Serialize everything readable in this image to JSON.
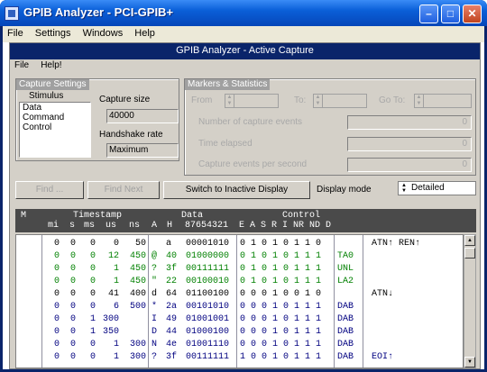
{
  "window": {
    "title": "GPIB Analyzer - PCI-GPIB+",
    "minimize": "–",
    "maximize": "□",
    "close": "✕"
  },
  "menubar": [
    {
      "label": "File"
    },
    {
      "label": "Settings"
    },
    {
      "label": "Windows"
    },
    {
      "label": "Help"
    }
  ],
  "child": {
    "title": "GPIB Analyzer - Active Capture",
    "menu": [
      {
        "label": "File"
      },
      {
        "label": "Help!"
      }
    ]
  },
  "capture_settings": {
    "caption": "Capture Settings",
    "stimulus_label": "Stimulus",
    "stimulus_items": [
      "Data",
      "Command",
      "Control"
    ],
    "capture_size_label": "Capture size",
    "capture_size_value": "40000",
    "handshake_label": "Handshake rate",
    "handshake_value": "Maximum"
  },
  "markers": {
    "caption": "Markers & Statistics",
    "from_label": "From",
    "to_label": "To:",
    "goto_label": "Go To:",
    "num_events_label": "Number of capture events",
    "num_events_value": "0",
    "time_elapsed_label": "Time elapsed",
    "time_elapsed_value": "0",
    "events_per_sec_label": "Capture events per second",
    "events_per_sec_value": "0"
  },
  "toolbar": {
    "find_label": "Find ...",
    "find_next_label": "Find Next",
    "switch_label": "Switch to Inactive Display",
    "display_mode_label": "Display mode",
    "display_mode_value": "Detailed"
  },
  "table": {
    "header_top": {
      "m": "M",
      "timestamp": "Timestamp",
      "data": "Data",
      "control": "Control"
    },
    "header_sub": {
      "mi": "mi",
      "s": "s",
      "ms": "ms",
      "us": "us",
      "ns": "ns",
      "a": "A",
      "h": "H",
      "bits": "87654321",
      "ctrl": "E A S R I NR ND D"
    },
    "rows": [
      {
        "color": "#000000",
        "mi": "0",
        "s": "0",
        "ms": "0",
        "us": "0",
        "ns": "50",
        "a": "",
        "h": "a",
        "bits": "00001010",
        "ctrl": "0 1 0 1 0  1 1 0",
        "mn": "",
        "extra": "ATN↑  REN↑"
      },
      {
        "color": "#008000",
        "mi": "0",
        "s": "0",
        "ms": "0",
        "us": "12",
        "ns": "450",
        "a": "@",
        "h": "40",
        "bits": "01000000",
        "ctrl": "0 1 0 1 0  1 1 1",
        "mn": "TA0",
        "extra": ""
      },
      {
        "color": "#008000",
        "mi": "0",
        "s": "0",
        "ms": "0",
        "us": "1",
        "ns": "450",
        "a": "?",
        "h": "3f",
        "bits": "00111111",
        "ctrl": "0 1 0 1 0  1 1 1",
        "mn": "UNL",
        "extra": ""
      },
      {
        "color": "#008000",
        "mi": "0",
        "s": "0",
        "ms": "0",
        "us": "1",
        "ns": "450",
        "a": "\"",
        "h": "22",
        "bits": "00100010",
        "ctrl": "0 1 0 1 0  1 1 1",
        "mn": "LA2",
        "extra": ""
      },
      {
        "color": "#000000",
        "mi": "0",
        "s": "0",
        "ms": "0",
        "us": "41",
        "ns": "400",
        "a": "d",
        "h": "64",
        "bits": "01100100",
        "ctrl": "0 0 0 1 0  0 1 0",
        "mn": "",
        "extra": "ATN↓"
      },
      {
        "color": "#000080",
        "mi": "0",
        "s": "0",
        "ms": "0",
        "us": "6",
        "ns": "500",
        "a": "*",
        "h": "2a",
        "bits": "00101010",
        "ctrl": "0 0 0 1 0  1 1 1",
        "mn": "DAB",
        "extra": ""
      },
      {
        "color": "#000080",
        "mi": "0",
        "s": "0",
        "ms": "1",
        "us": "300",
        "ns": "",
        "a": "I",
        "h": "49",
        "bits": "01001001",
        "ctrl": "0 0 0 1 0  1 1 1",
        "mn": "DAB",
        "extra": ""
      },
      {
        "color": "#000080",
        "mi": "0",
        "s": "0",
        "ms": "1",
        "us": "350",
        "ns": "",
        "a": "D",
        "h": "44",
        "bits": "01000100",
        "ctrl": "0 0 0 1 0  1 1 1",
        "mn": "DAB",
        "extra": ""
      },
      {
        "color": "#000080",
        "mi": "0",
        "s": "0",
        "ms": "0",
        "us": "1",
        "ns": "300",
        "a": "N",
        "h": "4e",
        "bits": "01001110",
        "ctrl": "0 0 0 1 0  1 1 1",
        "mn": "DAB",
        "extra": ""
      },
      {
        "color": "#000080",
        "mi": "0",
        "s": "0",
        "ms": "0",
        "us": "1",
        "ns": "300",
        "a": "?",
        "h": "3f",
        "bits": "00111111",
        "ctrl": "1 0 0 1 0  1 1 1",
        "mn": "DAB",
        "extra": "EOI↑"
      }
    ]
  },
  "icons": {
    "app": "gpib-app-icon",
    "scroll_up": "scroll-up-icon",
    "scroll_down": "scroll-down-icon",
    "spin": "spin-arrows-icon"
  }
}
